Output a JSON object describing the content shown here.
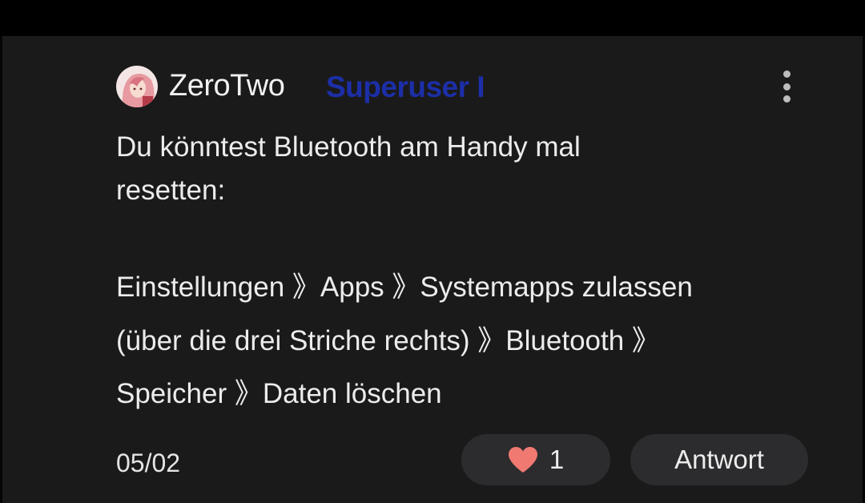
{
  "comment": {
    "author": "ZeroTwo",
    "badge": "Superuser I",
    "lines": [
      "Du könntest Bluetooth am Handy mal",
      "resetten:",
      "Einstellungen 》Apps 》Systemapps zulassen",
      "(über die drei Striche rechts) 》Bluetooth 》",
      "Speicher 》Daten löschen"
    ],
    "date": "05/02",
    "likes": "1",
    "reply_label": "Antwort"
  },
  "colors": {
    "background": "#1b1a1b",
    "badge": "#1c2fa8",
    "heart": "#f07a72",
    "button": "#2c2b2d"
  },
  "icons": {
    "more": "more-vertical-icon",
    "like": "heart-icon"
  }
}
